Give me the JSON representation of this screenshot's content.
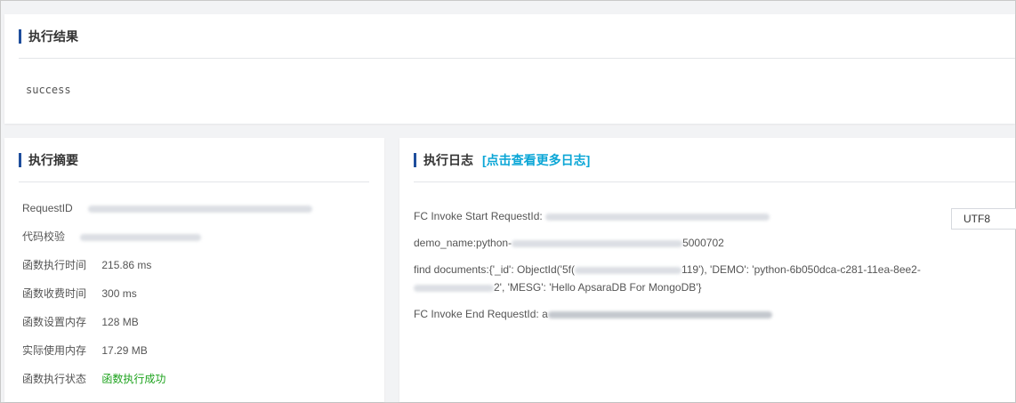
{
  "result": {
    "title": "执行结果",
    "text": "success"
  },
  "summary": {
    "title": "执行摘要",
    "rows": [
      {
        "label": "RequestID",
        "value": ""
      },
      {
        "label": "代码校验",
        "value": ""
      },
      {
        "label": "函数执行时间",
        "value": "215.86 ms"
      },
      {
        "label": "函数收费时间",
        "value": "300 ms"
      },
      {
        "label": "函数设置内存",
        "value": "128 MB"
      },
      {
        "label": "实际使用内存",
        "value": "17.29 MB"
      },
      {
        "label": "函数执行状态",
        "value": "函数执行成功"
      }
    ]
  },
  "log": {
    "title": "执行日志",
    "more_link": "[点击查看更多日志]",
    "encoding": "UTF8",
    "lines": {
      "start_prefix": "FC Invoke Start RequestId: ",
      "demo_prefix": "demo_name:python-",
      "demo_suffix": "5000702",
      "find_prefix": "find documents:{'_id': ObjectId('5f(",
      "find_mid": "119'), 'DEMO': 'python-6b050dca-c281-11ea-8ee2-",
      "find_cont_suffix": "2', 'MESG': 'Hello ApsaraDB For MongoDB'}",
      "end_prefix": "FC Invoke End RequestId: a"
    }
  }
}
